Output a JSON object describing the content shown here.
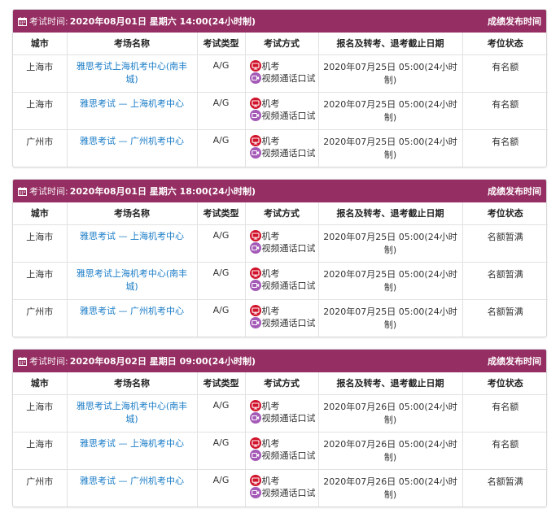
{
  "columns": [
    "城市",
    "考场名称",
    "考试类型",
    "考试方式",
    "报名及转考、退考截止日期",
    "考位状态"
  ],
  "exam_time_label": "考试时间:",
  "publish_label": "成绩发布时间",
  "mode_machine": "机考",
  "mode_video": "视频通话口试",
  "colors": {
    "header_bg": "#952e62",
    "link": "#1a7cc7",
    "machine_icon": "#d0122a",
    "video_icon": "#a45ab7"
  },
  "sessions": [
    {
      "datetime": "2020年08月01日 星期六 14:00(24小时制)",
      "rows": [
        {
          "city": "上海市",
          "center": "雅思考试上海机考中心(南丰城)",
          "type": "A/G",
          "deadline": "2020年07月25日 05:00(24小时制)",
          "status": "有名额"
        },
        {
          "city": "上海市",
          "center": "雅思考试 — 上海机考中心",
          "type": "A/G",
          "deadline": "2020年07月25日 05:00(24小时制)",
          "status": "有名额"
        },
        {
          "city": "广州市",
          "center": "雅思考试 — 广州机考中心",
          "type": "A/G",
          "deadline": "2020年07月25日 05:00(24小时制)",
          "status": "有名额"
        }
      ]
    },
    {
      "datetime": "2020年08月01日 星期六 18:00(24小时制)",
      "rows": [
        {
          "city": "上海市",
          "center": "雅思考试 — 上海机考中心",
          "type": "A/G",
          "deadline": "2020年07月25日 05:00(24小时制)",
          "status": "名额暂满"
        },
        {
          "city": "上海市",
          "center": "雅思考试上海机考中心(南丰城)",
          "type": "A/G",
          "deadline": "2020年07月25日 05:00(24小时制)",
          "status": "名额暂满"
        },
        {
          "city": "广州市",
          "center": "雅思考试 — 广州机考中心",
          "type": "A/G",
          "deadline": "2020年07月25日 05:00(24小时制)",
          "status": "名额暂满"
        }
      ]
    },
    {
      "datetime": "2020年08月02日 星期日 09:00(24小时制)",
      "rows": [
        {
          "city": "上海市",
          "center": "雅思考试上海机考中心(南丰城)",
          "type": "A/G",
          "deadline": "2020年07月26日 05:00(24小时制)",
          "status": "有名额"
        },
        {
          "city": "上海市",
          "center": "雅思考试 — 上海机考中心",
          "type": "A/G",
          "deadline": "2020年07月26日 05:00(24小时制)",
          "status": "有名额"
        },
        {
          "city": "广州市",
          "center": "雅思考试 — 广州机考中心",
          "type": "A/G",
          "deadline": "2020年07月26日 05:00(24小时制)",
          "status": "名额暂满"
        }
      ]
    }
  ]
}
